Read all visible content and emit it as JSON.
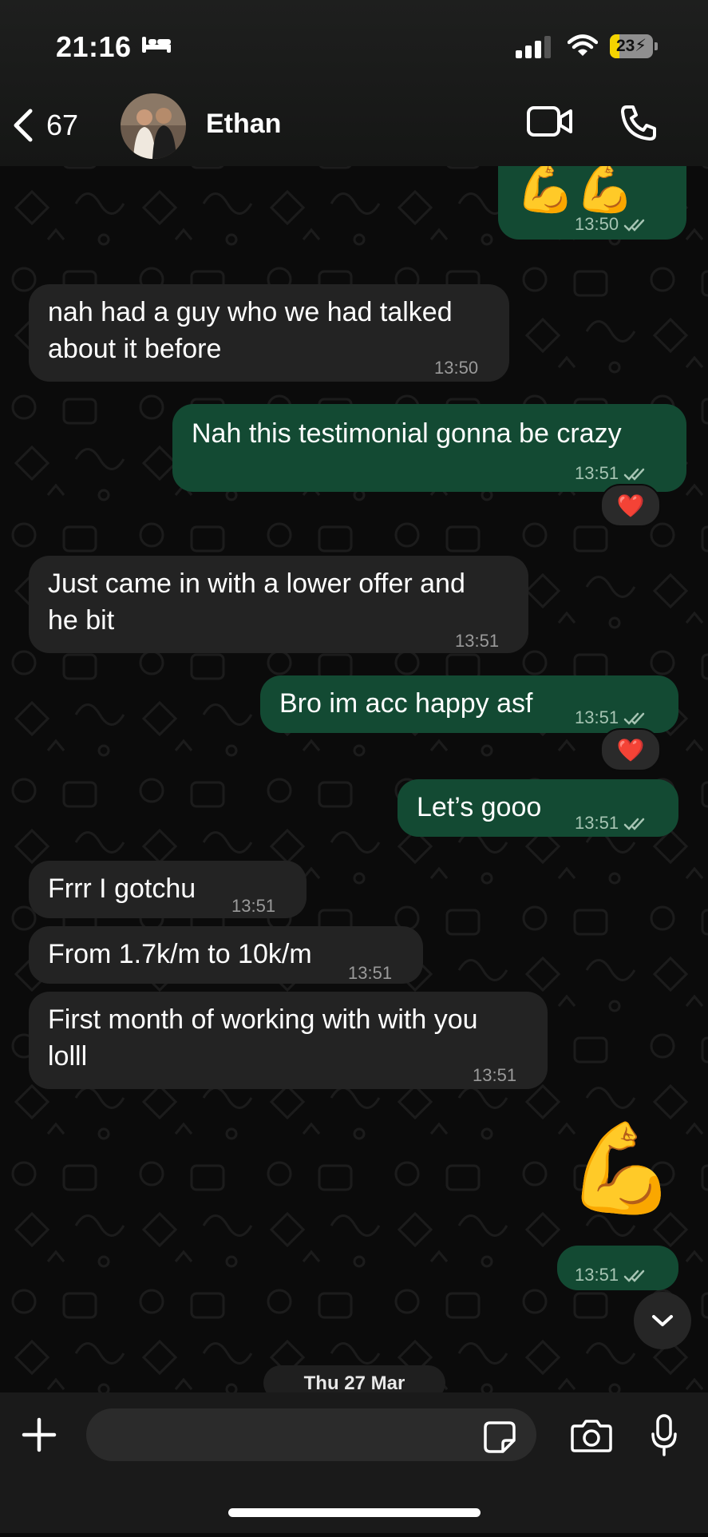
{
  "status_bar": {
    "time": "21:16",
    "battery": "23",
    "battery_level": 0.23,
    "sleep_icon": "bed-icon",
    "signal_icon": "cellular-signal-icon",
    "wifi_icon": "wifi-icon"
  },
  "header": {
    "back_count": "67",
    "contact_name": "Ethan",
    "icons": [
      "chevron-left-icon",
      "video-camera-icon",
      "phone-icon"
    ]
  },
  "messages": [
    {
      "direction": "out",
      "text": "💪💪",
      "time": "13:50",
      "read": true
    },
    {
      "direction": "in",
      "lines": [
        "nah had a guy who we had talked",
        "about it before"
      ],
      "time": "13:50"
    },
    {
      "direction": "out",
      "text": "Nah this testimonial gonna be crazy",
      "time": "13:51",
      "read": true,
      "reaction": "❤️"
    },
    {
      "direction": "in",
      "lines": [
        "Just came in with a lower offer and",
        "he bit"
      ],
      "time": "13:51"
    },
    {
      "direction": "out",
      "text": "Bro im acc happy asf",
      "time": "13:51",
      "read": true,
      "reaction": "❤️"
    },
    {
      "direction": "out",
      "text": "Let’s gooo",
      "time": "13:51",
      "read": true
    },
    {
      "direction": "in",
      "text": "Frrr I gotchu",
      "time": "13:51"
    },
    {
      "direction": "in",
      "text": "From 1.7k/m to 10k/m",
      "time": "13:51"
    },
    {
      "direction": "in",
      "lines": [
        "First month of working with with you",
        "lolll"
      ],
      "time": "13:51"
    },
    {
      "direction": "out",
      "text": "💪",
      "time": "13:51",
      "read": true
    }
  ],
  "date_divider": "Thu 27 Mar",
  "composer": {
    "placeholder": "",
    "icons": [
      "plus-icon",
      "sticker-icon",
      "camera-icon",
      "microphone-icon"
    ]
  },
  "colors": {
    "incoming_bubble": "#232323",
    "outgoing_bubble": "#134a33",
    "background": "#0b0b0b",
    "battery_accent": "#f4d400"
  }
}
